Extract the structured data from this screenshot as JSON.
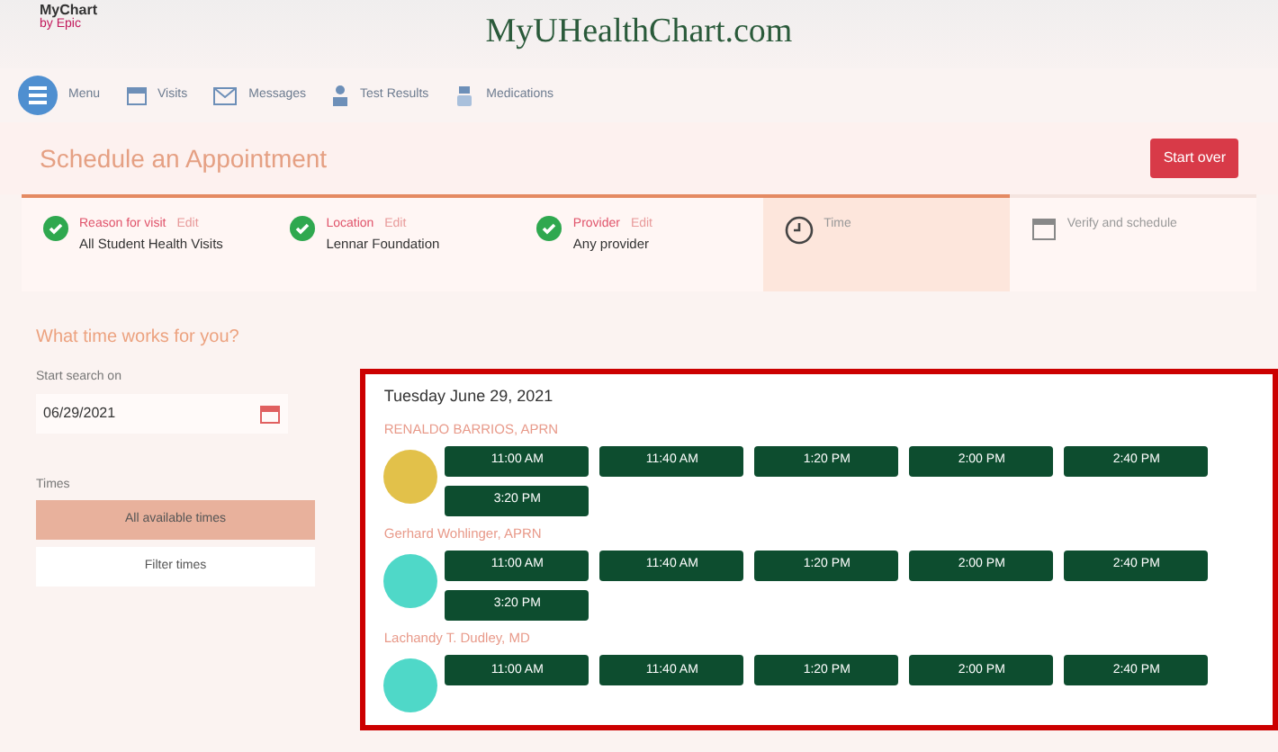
{
  "header": {
    "logo_top": "MyChart",
    "logo_bottom": "by Epic",
    "site_title": "MyUHealthChart.com"
  },
  "nav": [
    {
      "label": "Menu",
      "kind": "menu"
    },
    {
      "label": "Visits",
      "kind": "calendar"
    },
    {
      "label": "Messages",
      "kind": "mail"
    },
    {
      "label": "Test Results",
      "kind": "person"
    },
    {
      "label": "Medications",
      "kind": "pill"
    }
  ],
  "page_title": "Schedule an Appointment",
  "start_over": "Start over",
  "progress": {
    "level": 0.8
  },
  "steps": [
    {
      "label": "Reason for visit",
      "edit": "Edit",
      "value": "All Student Health Visits",
      "kind": "done",
      "selected": false
    },
    {
      "label": "Location",
      "edit": "Edit",
      "value": "Lennar Foundation",
      "kind": "done",
      "selected": false
    },
    {
      "label": "Provider",
      "edit": "Edit",
      "value": "Any provider",
      "kind": "done",
      "selected": false
    },
    {
      "label": "Time",
      "kind": "time",
      "selected": true
    },
    {
      "label": "Verify and schedule",
      "kind": "verify",
      "selected": false
    }
  ],
  "question": "What time works for you?",
  "search": {
    "label": "Start search on",
    "value": "06/29/2021"
  },
  "times": {
    "label": "Times",
    "options": [
      {
        "label": "All available times",
        "selected": true
      },
      {
        "label": "Filter times",
        "selected": false
      }
    ]
  },
  "results": {
    "date": "Tuesday June 29, 2021",
    "providers": [
      {
        "name": "RENALDO BARRIOS, APRN",
        "color": "#e2c14a",
        "slots": [
          "11:00 AM",
          "11:40 AM",
          "1:20 PM",
          "2:00 PM",
          "2:40 PM",
          "3:20 PM"
        ]
      },
      {
        "name": "Gerhard Wohlinger, APRN",
        "color": "#4fd8c8",
        "slots": [
          "11:00 AM",
          "11:40 AM",
          "1:20 PM",
          "2:00 PM",
          "2:40 PM",
          "3:20 PM"
        ]
      },
      {
        "name": "Lachandy T. Dudley, MD",
        "color": "#4fd8c8",
        "slots": [
          "11:00 AM",
          "11:40 AM",
          "1:20 PM",
          "2:00 PM",
          "2:40 PM"
        ]
      }
    ]
  }
}
